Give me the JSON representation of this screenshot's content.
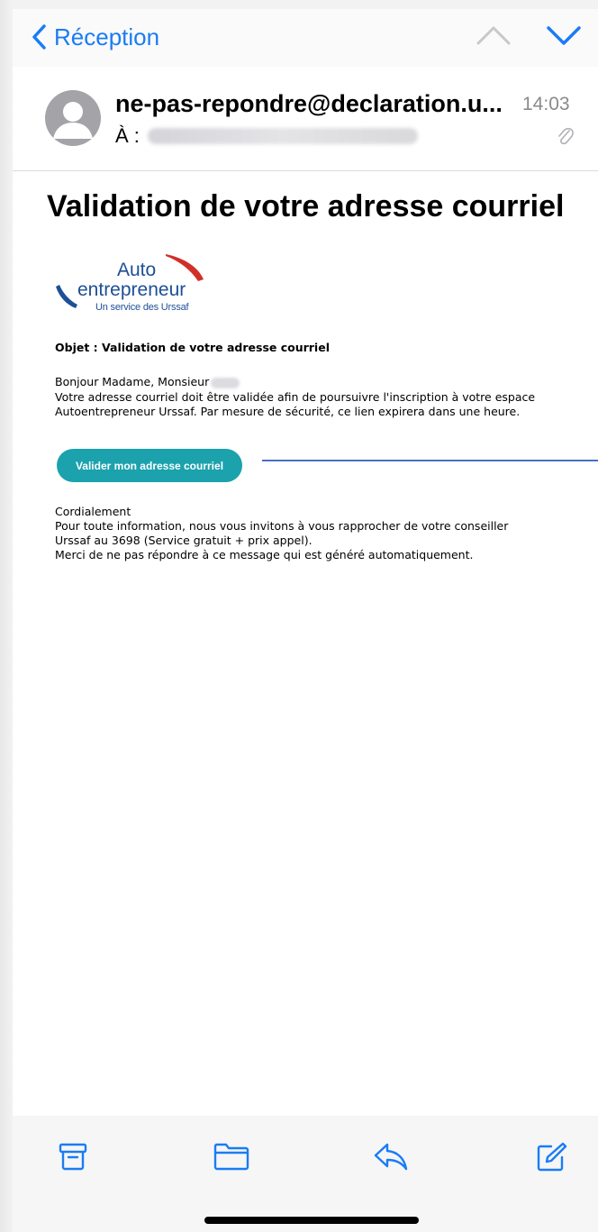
{
  "nav": {
    "back_label": "Réception"
  },
  "message": {
    "sender": "ne-pas-repondre@declaration.u...",
    "time": "14:03",
    "to_label": "À :"
  },
  "email": {
    "title": "Validation de votre adresse courriel",
    "logo": {
      "line1": "Auto",
      "line2": "entrepreneur",
      "line3": "Un service des Urssaf"
    },
    "objet": "Objet : Validation de votre adresse courriel",
    "greeting": "Bonjour Madame, Monsieur",
    "paragraph1": "Votre adresse courriel doit être validée afin de poursuivre l'inscription à votre espace Autoentrepreneur Urssaf. Par mesure de sécurité, ce lien expirera dans une heure.",
    "button_label": "Valider mon adresse courriel",
    "closing": {
      "line1": "Cordialement",
      "line2": "Pour toute information, nous vous invitons à vous rapprocher de votre conseiller",
      "line3": "Urssaf au 3698 (Service gratuit + prix appel).",
      "line4": "Merci de ne pas répondre à ce message qui est généré automatiquement."
    }
  },
  "icons": {
    "back": "chevron-left-icon",
    "up": "chevron-up-icon",
    "down": "chevron-down-icon",
    "attachment": "paperclip-icon",
    "archive": "archive-icon",
    "folder": "folder-icon",
    "reply": "reply-icon",
    "compose": "compose-icon"
  },
  "colors": {
    "accent": "#1a7cf5",
    "button": "#1ba2ad",
    "logo_blue": "#1d4f96",
    "logo_red": "#d1302a",
    "annotation": "#4a6fc4"
  }
}
